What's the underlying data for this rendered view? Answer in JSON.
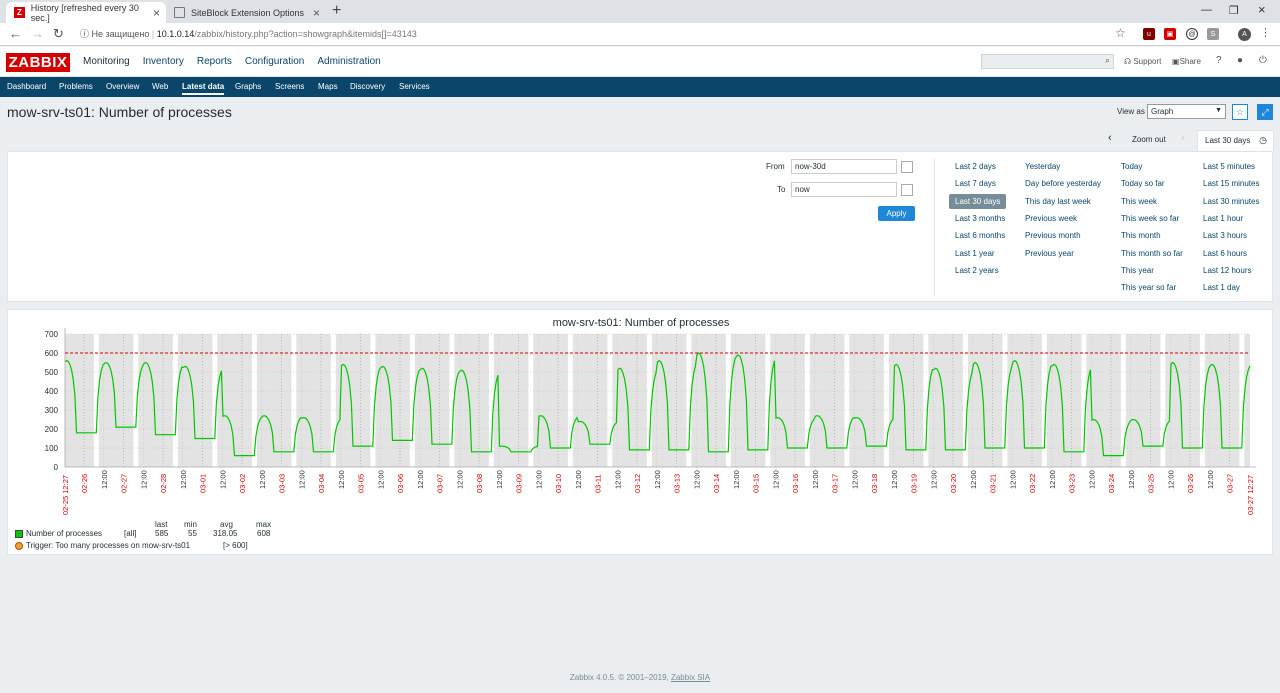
{
  "browser": {
    "tabs": [
      {
        "title": "History [refreshed every 30 sec.]",
        "icon": "Z"
      },
      {
        "title": "SiteBlock Extension Options",
        "icon": ""
      }
    ],
    "insecure_label": "Не защищено",
    "url_host": "10.1.0.14",
    "url_path": "/zabbix/history.php?action=showgraph&itemids[]=43143"
  },
  "header": {
    "logo": "ZABBIX",
    "menu": [
      "Monitoring",
      "Inventory",
      "Reports",
      "Configuration",
      "Administration"
    ],
    "support": "Support",
    "share": "Share",
    "help": "?"
  },
  "submenu": [
    "Dashboard",
    "Problems",
    "Overview",
    "Web",
    "Latest data",
    "Graphs",
    "Screens",
    "Maps",
    "Discovery",
    "Services"
  ],
  "page": {
    "title": "mow-srv-ts01: Number of processes",
    "view_as_label": "View as",
    "view_as_value": "Graph"
  },
  "timebar": {
    "zoom_out": "Zoom out",
    "current": "Last 30 days"
  },
  "filter": {
    "from_label": "From",
    "from_value": "now-30d",
    "to_label": "To",
    "to_value": "now",
    "apply": "Apply",
    "quick": [
      [
        "Last 2 days",
        "Last 7 days",
        "Last 30 days",
        "Last 3 months",
        "Last 6 months",
        "Last 1 year",
        "Last 2 years"
      ],
      [
        "Yesterday",
        "Day before yesterday",
        "This day last week",
        "Previous week",
        "Previous month",
        "Previous year"
      ],
      [
        "Today",
        "Today so far",
        "This week",
        "This week so far",
        "This month",
        "This month so far",
        "This year",
        "This year so far"
      ],
      [
        "Last 5 minutes",
        "Last 15 minutes",
        "Last 30 minutes",
        "Last 1 hour",
        "Last 3 hours",
        "Last 6 hours",
        "Last 12 hours",
        "Last 1 day"
      ]
    ]
  },
  "chart_data": {
    "type": "line",
    "title": "mow-srv-ts01: Number of processes",
    "ylim": [
      0,
      700
    ],
    "yticks": [
      0,
      100,
      200,
      300,
      400,
      500,
      600,
      700
    ],
    "x_start_label": "02-25 12:27",
    "x_end_label": "03-27 12:27",
    "day_labels": [
      "02-26",
      "02-27",
      "02-28",
      "03-01",
      "03-02",
      "03-03",
      "03-04",
      "03-05",
      "03-06",
      "03-07",
      "03-08",
      "03-09",
      "03-10",
      "03-11",
      "03-12",
      "03-13",
      "03-14",
      "03-15",
      "03-16",
      "03-17",
      "03-18",
      "03-19",
      "03-20",
      "03-21",
      "03-22",
      "03-23",
      "03-24",
      "03-25",
      "03-26",
      "03-27"
    ],
    "mid_label": "12:00",
    "trigger_value": 600,
    "series": [
      {
        "name": "Number of processes",
        "color": "#00c800",
        "daily_peaks": [
          560,
          550,
          550,
          530,
          270,
          270,
          260,
          540,
          530,
          520,
          510,
          110,
          270,
          240,
          520,
          560,
          600,
          590,
          260,
          270,
          260,
          540,
          520,
          550,
          560,
          540,
          250,
          250,
          550,
          540
        ],
        "daily_mins": [
          180,
          210,
          170,
          150,
          60,
          80,
          80,
          110,
          140,
          120,
          80,
          80,
          100,
          120,
          90,
          90,
          80,
          90,
          100,
          100,
          110,
          90,
          90,
          100,
          100,
          80,
          60,
          110,
          100,
          100
        ]
      }
    ],
    "legend": {
      "headers": [
        "last",
        "min",
        "avg",
        "max"
      ],
      "item": "Number of processes",
      "func": "[all]",
      "values": [
        "585",
        "55",
        "318.05",
        "608"
      ],
      "trigger": "Trigger: Too many processes on mow-srv-ts01",
      "trigger_cond": "[> 600]"
    }
  },
  "footer": {
    "text": "Zabbix 4.0.5. © 2001–2019, ",
    "link": "Zabbix SIA"
  }
}
